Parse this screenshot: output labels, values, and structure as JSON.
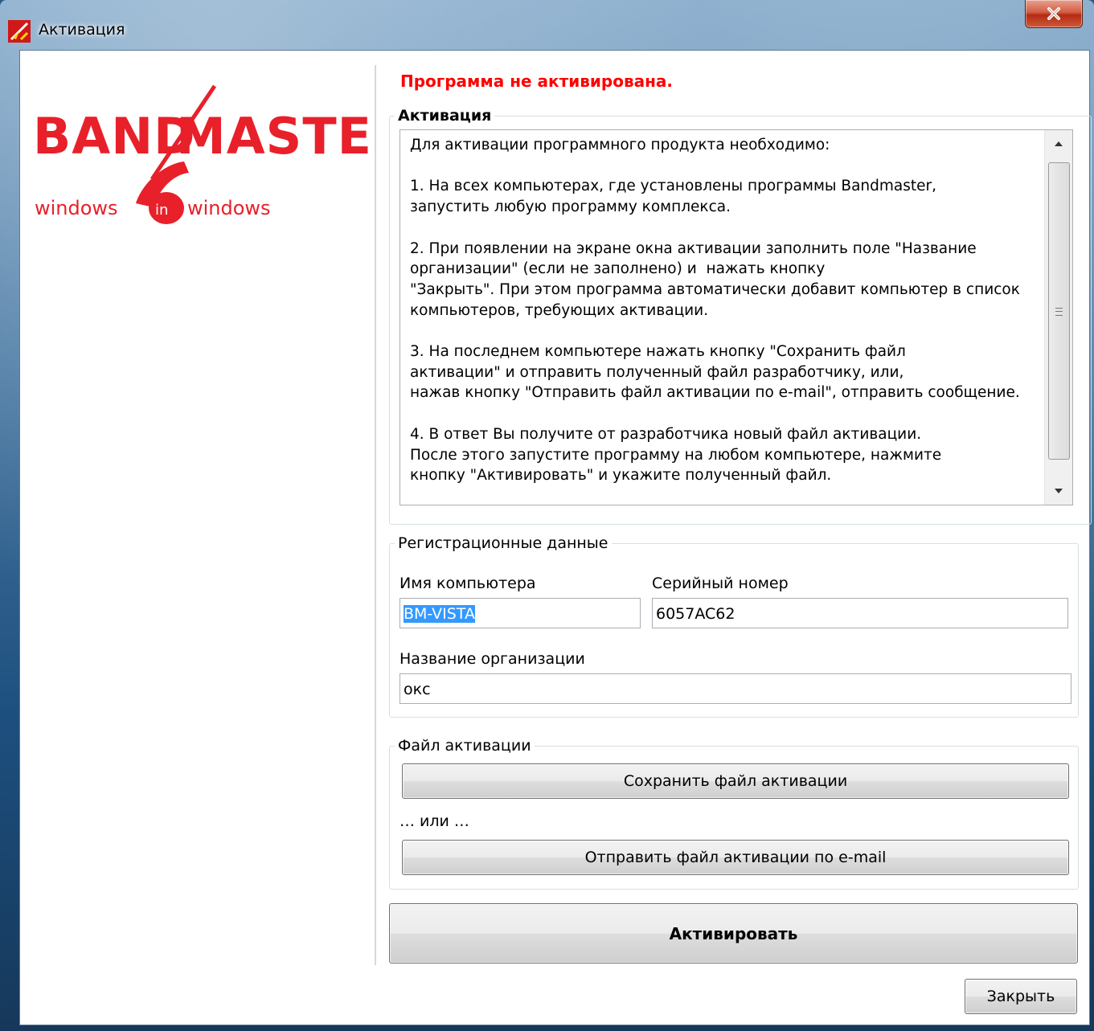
{
  "window": {
    "title": "Активация",
    "close_glyph": "x"
  },
  "logo": {
    "brand": "BAND MASTER",
    "tagline": "windows in windows",
    "brand_color": "#e8202a"
  },
  "status": {
    "text": "Программа не активирована.",
    "color": "#ff0000"
  },
  "activation": {
    "legend": "Активация",
    "instructions": "Для активации программного продукта необходимо:\n\n1. На всех компьютерах, где установлены программы Bandmaster,\nзапустить любую программу комплекса.\n\n2. При появлении на экране окна активации заполнить поле \"Название организации\" (если не заполнено) и  нажать кнопку\n\"Закрыть\". При этом программа автоматически добавит компьютер в список компьютеров, требующих активации.\n\n3. На последнем компьютере нажать кнопку \"Сохранить файл\nактивации\" и отправить полученный файл разработчику, или,\nнажав кнопку \"Отправить файл активации по e-mail\", отправить сообщение.\n\n4. В ответ Вы получите от разработчика новый файл активации.\nПосле этого запустите программу на любом компьютере, нажмите\nкнопку \"Активировать\" и укажите полученный файл."
  },
  "registration": {
    "legend": "Регистрационные данные",
    "computer_name_label": "Имя компьютера",
    "computer_name_value": "BM-VISTA",
    "serial_label": "Серийный номер",
    "serial_value": "6057AC62",
    "org_label": "Название организации",
    "org_value": "окс"
  },
  "activation_file": {
    "legend": "Файл активации",
    "save_button": "Сохранить файл активации",
    "or_text": "… или …",
    "email_button": "Отправить файл активации по e-mail"
  },
  "activate_button": "Активировать",
  "close_button": "Закрыть"
}
